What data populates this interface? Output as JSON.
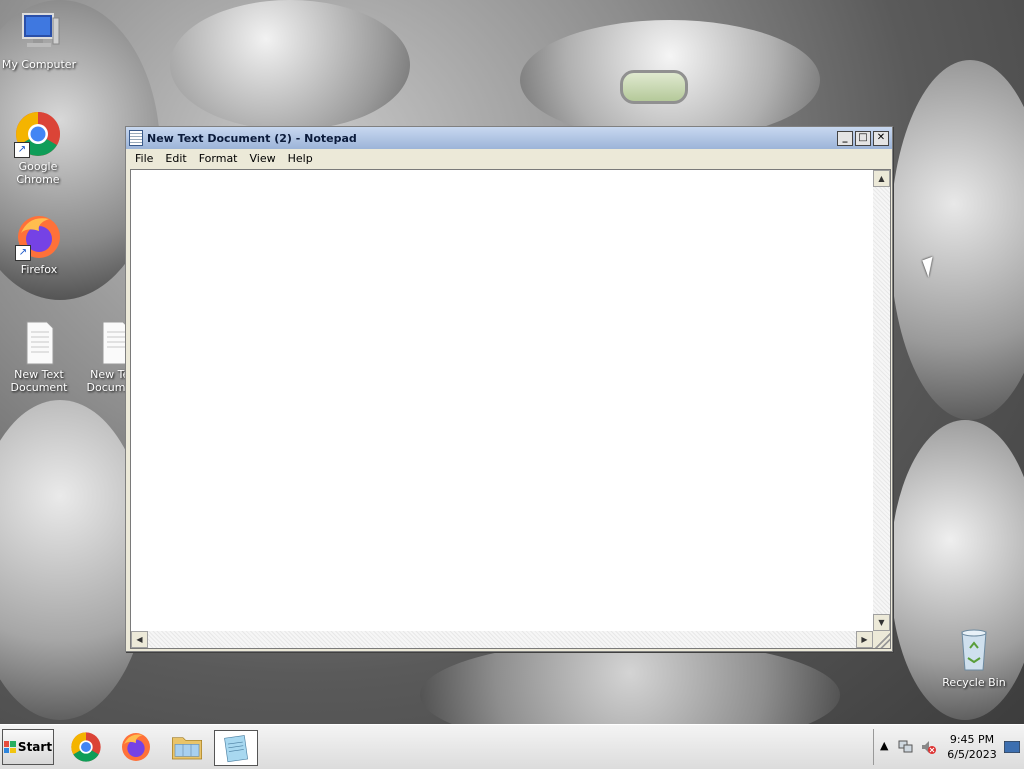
{
  "desktop": {
    "icons": [
      {
        "label": "My Computer"
      },
      {
        "label": "Google Chrome"
      },
      {
        "label": "Firefox"
      },
      {
        "label": "New Text Document"
      },
      {
        "label": "New Text Document"
      },
      {
        "label": "Recycle Bin"
      }
    ]
  },
  "notepad": {
    "title": "New Text Document (2) - Notepad",
    "menu": [
      "File",
      "Edit",
      "Format",
      "View",
      "Help"
    ],
    "content": "",
    "buttons": {
      "minimize": "_",
      "maximize": "□",
      "close": "✕"
    }
  },
  "taskbar": {
    "start_label": "Start",
    "apps": [
      "chrome-icon",
      "firefox-icon",
      "file-explorer-icon",
      "notepad-icon"
    ],
    "clock": {
      "time": "9:45 PM",
      "date": "6/5/2023"
    }
  }
}
